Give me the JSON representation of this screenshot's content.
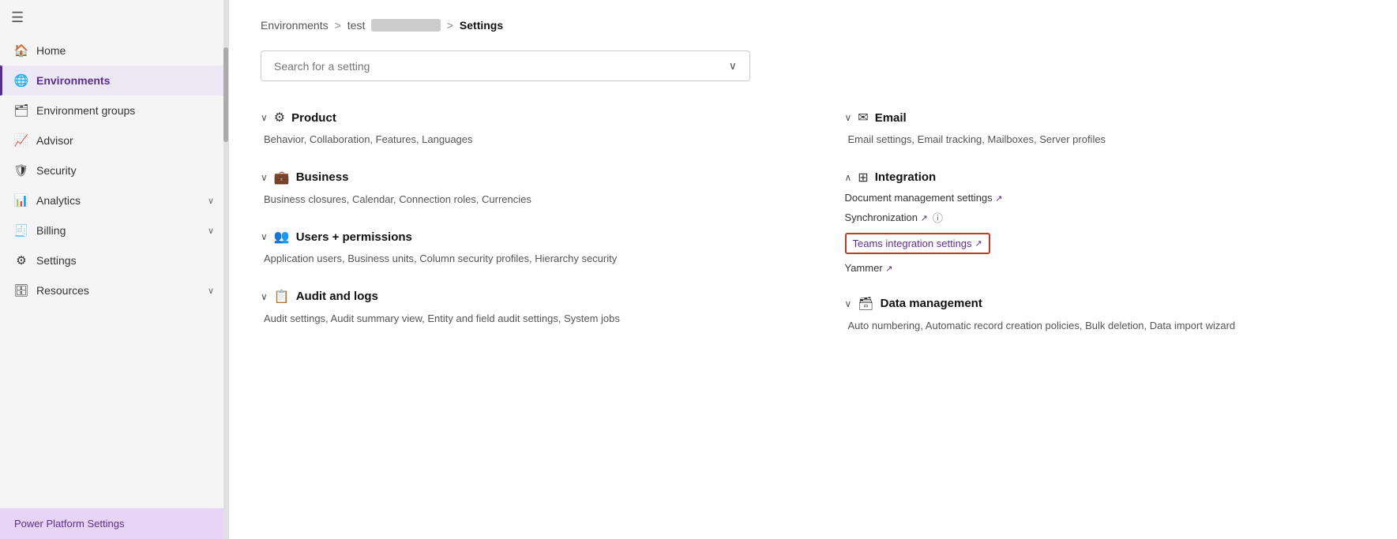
{
  "sidebar": {
    "hamburger": "☰",
    "items": [
      {
        "id": "home",
        "label": "Home",
        "icon": "🏠",
        "active": false
      },
      {
        "id": "environments",
        "label": "Environments",
        "icon": "🌐",
        "active": true
      },
      {
        "id": "environment-groups",
        "label": "Environment groups",
        "icon": "🗂",
        "active": false
      },
      {
        "id": "advisor",
        "label": "Advisor",
        "icon": "📈",
        "active": false
      },
      {
        "id": "security",
        "label": "Security",
        "icon": "🛡",
        "active": false
      },
      {
        "id": "analytics",
        "label": "Analytics",
        "icon": "📊",
        "active": false,
        "chevron": "∨"
      },
      {
        "id": "billing",
        "label": "Billing",
        "icon": "🧾",
        "active": false,
        "chevron": "∨"
      },
      {
        "id": "settings",
        "label": "Settings",
        "icon": "⚙",
        "active": false
      },
      {
        "id": "resources",
        "label": "Resources",
        "icon": "🗄",
        "active": false,
        "chevron": "∨"
      }
    ],
    "bottom_label": "Power Platform Settings"
  },
  "breadcrumb": {
    "environments": "Environments",
    "sep1": ">",
    "test": "test",
    "blurred": "████████",
    "sep2": ">",
    "current": "Settings"
  },
  "search": {
    "placeholder": "Search for a setting"
  },
  "sections": {
    "left": [
      {
        "id": "product",
        "chevron": "∨",
        "icon": "⚙",
        "title": "Product",
        "description": "Behavior, Collaboration, Features, Languages"
      },
      {
        "id": "business",
        "chevron": "∨",
        "icon": "💼",
        "title": "Business",
        "description": "Business closures, Calendar, Connection roles, Currencies"
      },
      {
        "id": "users-permissions",
        "chevron": "∨",
        "icon": "👥",
        "title": "Users + permissions",
        "description": "Application users, Business units, Column security profiles, Hierarchy security"
      },
      {
        "id": "audit-logs",
        "chevron": "∨",
        "icon": "📋",
        "title": "Audit and logs",
        "description": "Audit settings, Audit summary view, Entity and field audit settings, System jobs"
      }
    ],
    "right": [
      {
        "id": "email",
        "chevron": "∨",
        "icon": "✉",
        "title": "Email",
        "description": "Email settings, Email tracking, Mailboxes, Server profiles"
      },
      {
        "id": "integration",
        "chevron": "∧",
        "icon": "⊞",
        "title": "Integration",
        "links": [
          {
            "id": "doc-mgmt",
            "label": "Document management settings",
            "ext": true
          },
          {
            "id": "sync",
            "label": "Synchronization",
            "ext": true,
            "info": true
          },
          {
            "id": "teams",
            "label": "Teams integration settings",
            "ext": true,
            "highlight": true
          },
          {
            "id": "yammer",
            "label": "Yammer",
            "ext": true
          }
        ]
      },
      {
        "id": "data-mgmt",
        "chevron": "∨",
        "icon": "🗃",
        "title": "Data management",
        "description": "Auto numbering, Automatic record creation policies, Bulk deletion, Data import wizard"
      }
    ]
  }
}
